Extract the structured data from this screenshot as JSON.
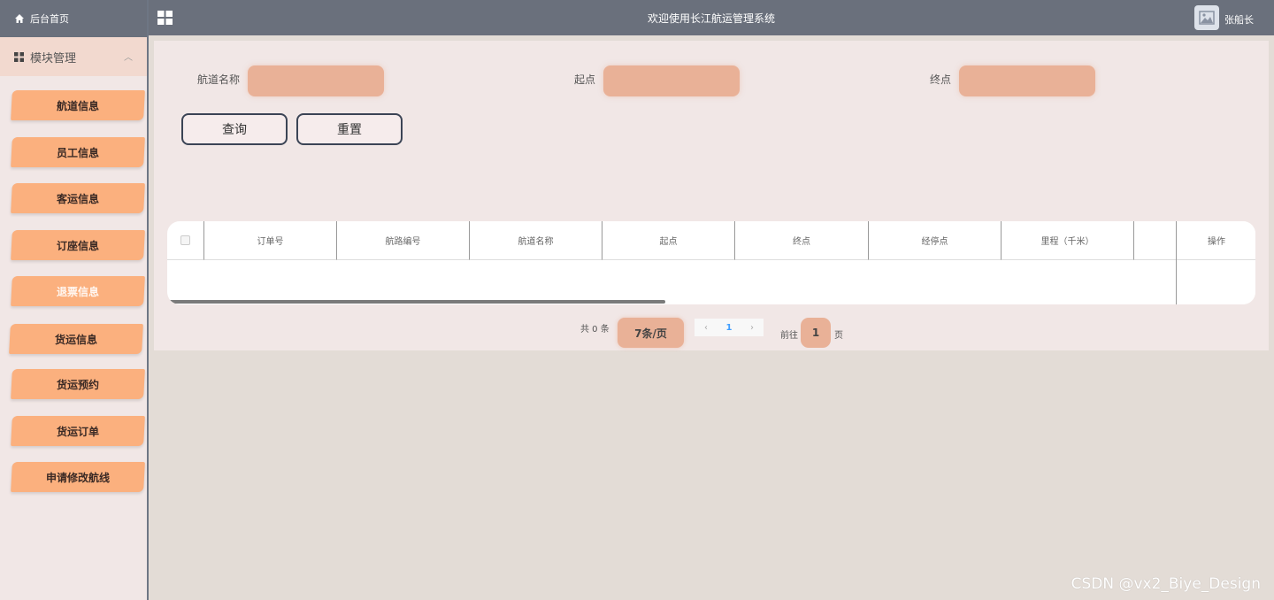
{
  "sidebar": {
    "home_label": "后台首页",
    "module_label": "模块管理",
    "items": [
      {
        "label": "航道信息"
      },
      {
        "label": "员工信息"
      },
      {
        "label": "客运信息"
      },
      {
        "label": "订座信息"
      },
      {
        "label": "退票信息"
      },
      {
        "label": "货运信息"
      },
      {
        "label": "货运预约"
      },
      {
        "label": "货运订单"
      },
      {
        "label": "申请修改航线"
      }
    ]
  },
  "header": {
    "title": "欢迎使用长江航运管理系统",
    "username": "张船长"
  },
  "search": {
    "fields": [
      {
        "label": "航道名称",
        "value": ""
      },
      {
        "label": "起点",
        "value": ""
      },
      {
        "label": "终点",
        "value": ""
      }
    ],
    "query_label": "查询",
    "reset_label": "重置"
  },
  "table": {
    "columns": [
      "订单号",
      "航路编号",
      "航道名称",
      "起点",
      "终点",
      "经停点",
      "里程（千米）",
      ""
    ],
    "action_column": "操作",
    "rows": []
  },
  "pagination": {
    "total_text": "共 0 条",
    "page_size_label": "7条/页",
    "prev": "‹",
    "current_page": "1",
    "next": "›",
    "goto_label": "前往",
    "goto_value": "1",
    "page_unit": "页"
  },
  "watermark": "CSDN @vx2_Biye_Design",
  "colors": {
    "accent_orange": "#fbb07e",
    "input_fill": "#e9b197",
    "header_gray": "#6a707c"
  }
}
